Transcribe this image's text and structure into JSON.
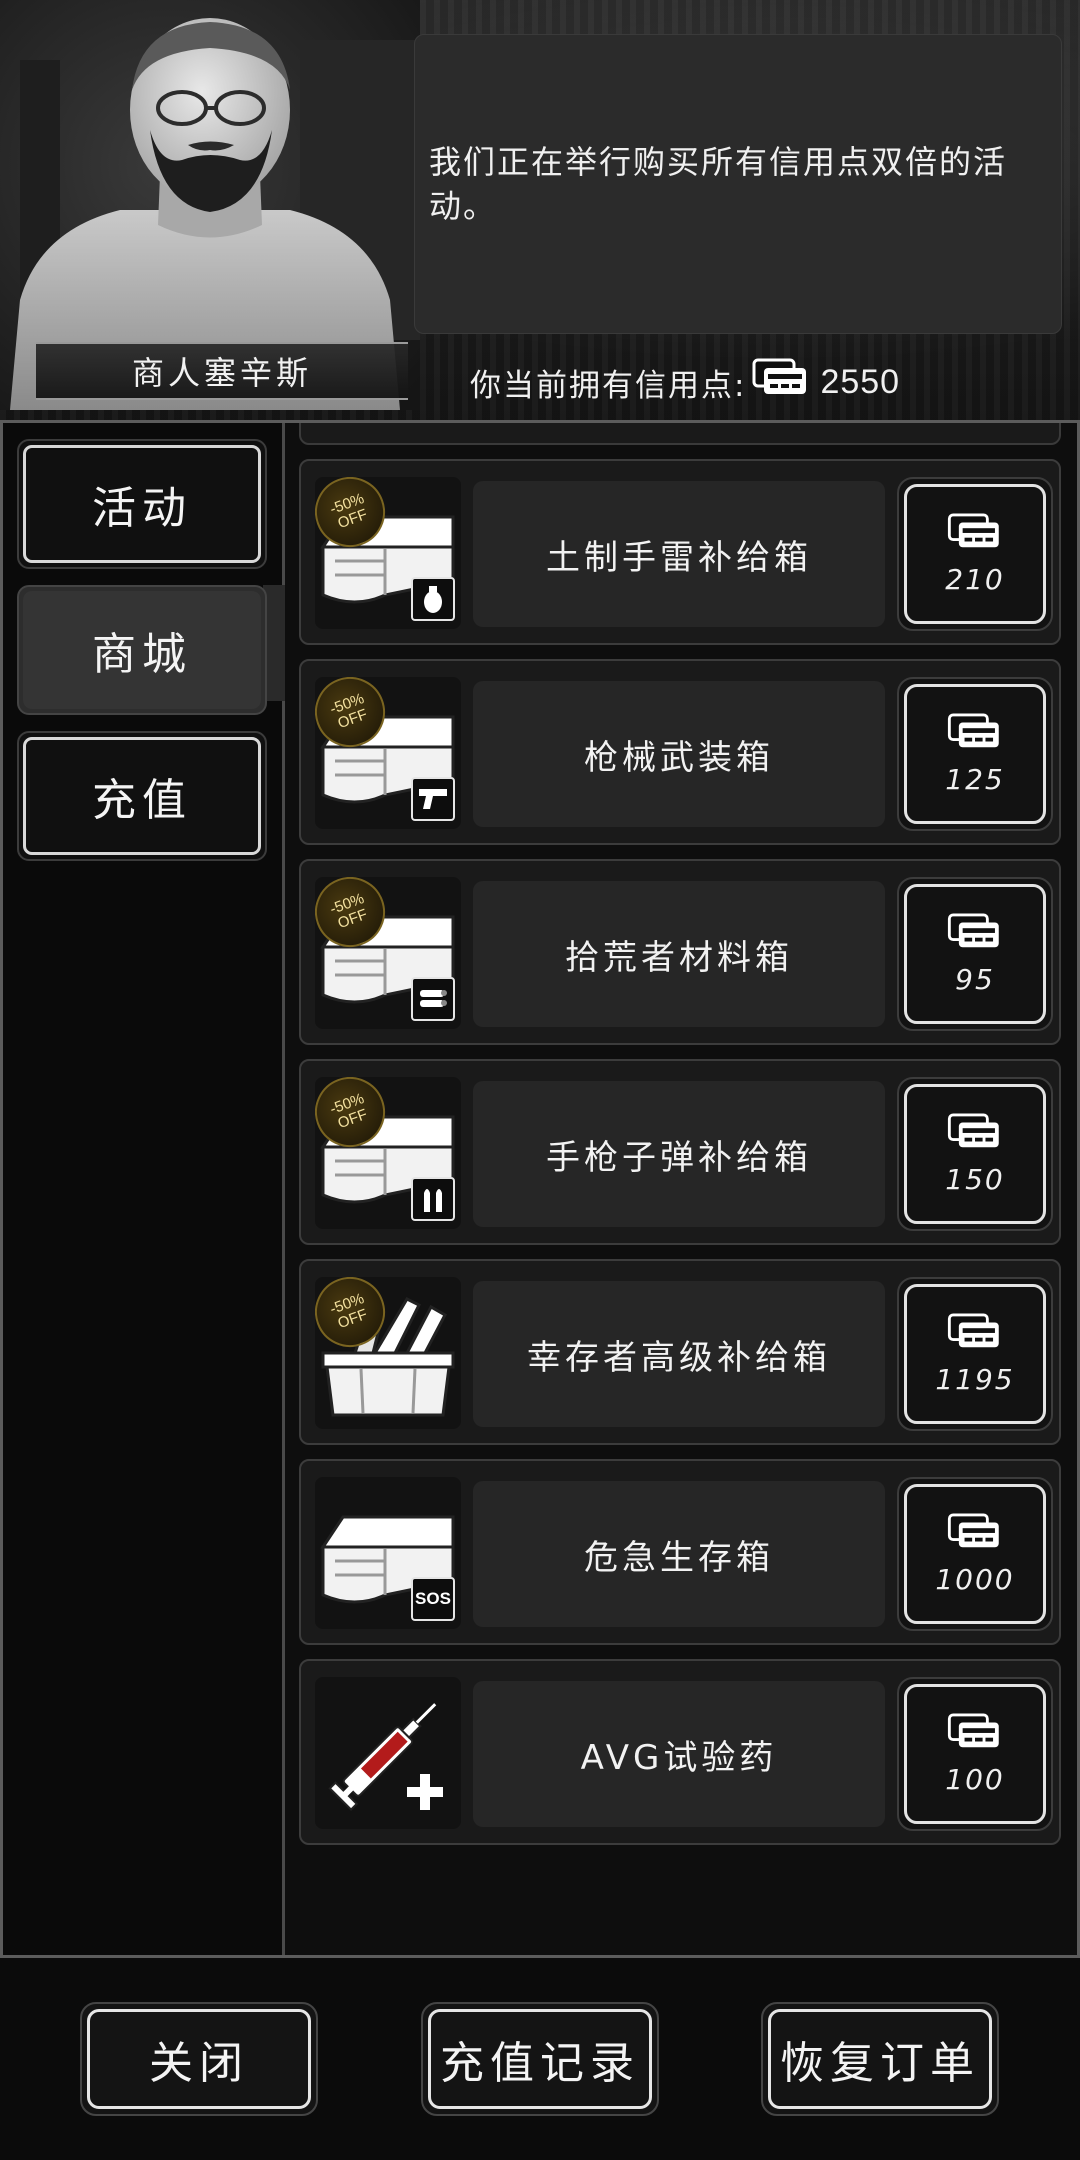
{
  "header": {
    "merchant_name": "商人塞辛斯",
    "dialog_text": "我们正在举行购买所有信用点双倍的活动。",
    "credits_label": "你当前拥有信用点:",
    "credits_value": "2550"
  },
  "sidebar": {
    "tabs": [
      {
        "label": "活动",
        "active": false
      },
      {
        "label": "商城",
        "active": true
      },
      {
        "label": "充值",
        "active": false
      }
    ]
  },
  "items": [
    {
      "name": "土制手雷补给箱",
      "price": "210",
      "badge": {
        "line1": "-50%",
        "line2": "OFF"
      },
      "icon": "crate-grenade-icon"
    },
    {
      "name": "枪械武装箱",
      "price": "125",
      "badge": {
        "line1": "-50%",
        "line2": "OFF"
      },
      "icon": "crate-pistol-icon"
    },
    {
      "name": "拾荒者材料箱",
      "price": "95",
      "badge": {
        "line1": "-50%",
        "line2": "OFF"
      },
      "icon": "crate-materials-icon"
    },
    {
      "name": "手枪子弹补给箱",
      "price": "150",
      "badge": {
        "line1": "-50%",
        "line2": "OFF"
      },
      "icon": "crate-ammo-icon"
    },
    {
      "name": "幸存者高级补给箱",
      "price": "1195",
      "badge": {
        "line1": "-50%",
        "line2": "OFF"
      },
      "icon": "crate-tools-icon"
    },
    {
      "name": "危急生存箱",
      "price": "1000",
      "sub_label": "SOS",
      "icon": "crate-sos-icon"
    },
    {
      "name": "AVG试验药",
      "price": "100",
      "icon": "syringe-icon"
    }
  ],
  "footer": {
    "close_label": "关闭",
    "history_label": "充值记录",
    "restore_label": "恢复订单"
  },
  "colors": {
    "background": "#0b0b0b",
    "card": "#1a1a1a",
    "name_box": "#262626",
    "button_border": "#e3e3e3",
    "badge_gold": "#f4e2a0"
  }
}
